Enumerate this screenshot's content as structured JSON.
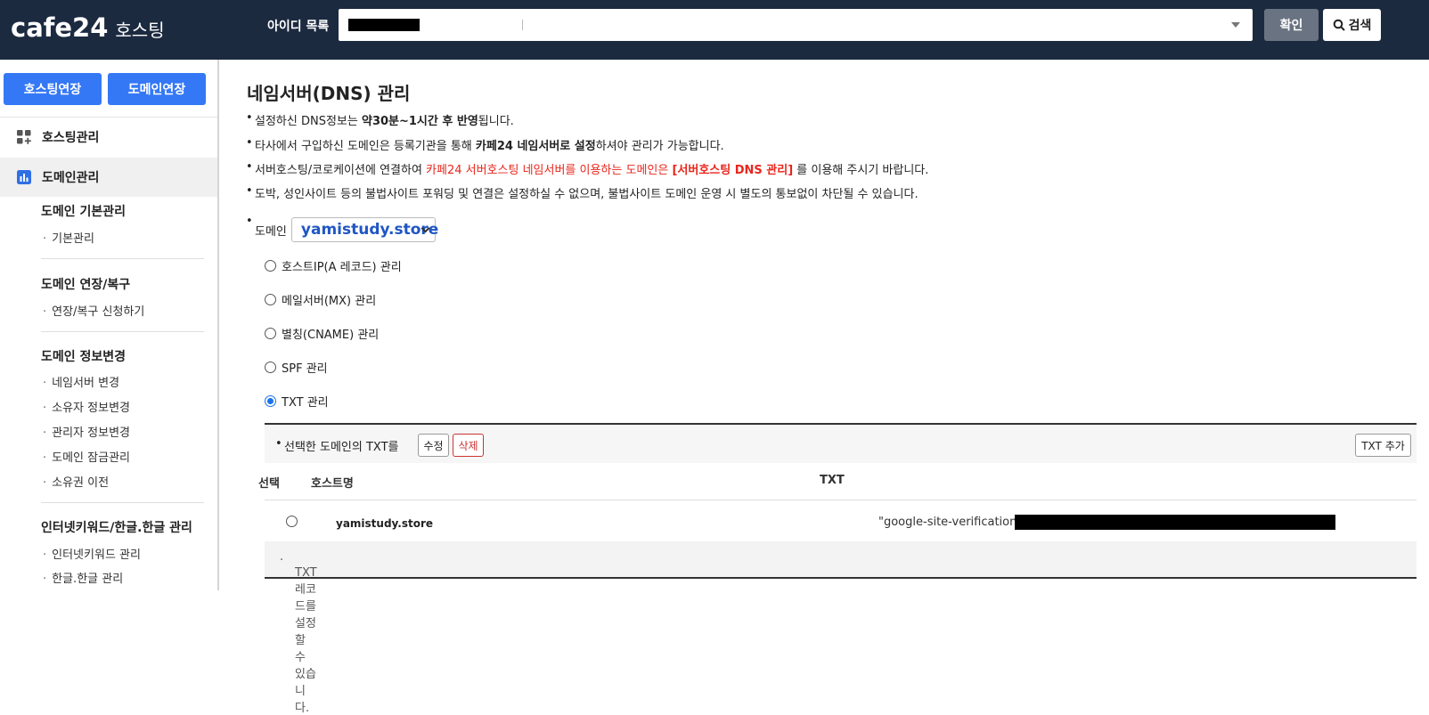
{
  "header": {
    "logo_main": "cafe24",
    "logo_sub": "호스팅",
    "id_label": "아이디 목록",
    "confirm_label": "확인",
    "search_label": "검색",
    "search_icon": "search-icon"
  },
  "sidebar": {
    "hosting_extend_label": "호스팅연장",
    "domain_extend_label": "도메인연장",
    "menus": [
      {
        "label": "호스팅관리",
        "icon": "grid-plus-icon"
      },
      {
        "label": "도메인관리",
        "icon": "bar-chart-icon"
      }
    ],
    "groups": [
      {
        "title": "도메인 기본관리",
        "items": [
          "기본관리"
        ]
      },
      {
        "title": "도메인 연장/복구",
        "items": [
          "연장/복구 신청하기"
        ]
      },
      {
        "title": "도메인 정보변경",
        "items": [
          "네임서버 변경",
          "소유자 정보변경",
          "관리자 정보변경",
          "도메인 잠금관리",
          "소유권 이전"
        ]
      },
      {
        "title": "인터넷키워드/한글.한글 관리",
        "items": [
          "인터넷키워드 관리",
          "한글.한글 관리"
        ]
      }
    ]
  },
  "main": {
    "title": "네임서버(DNS) 관리",
    "notices": {
      "n1_a": "설정하신 DNS정보는 ",
      "n1_b": "약30분~1시간 후 반영",
      "n1_c": "됩니다.",
      "n2_a": "타사에서 구입하신 도메인은 등록기관을 통해 ",
      "n2_b": "카페24 네임서버로 설정",
      "n2_c": "하셔야 관리가 가능합니다.",
      "n3_a": "서버호스팅/코로케이션에 연결하여 ",
      "n3_b": "카페24 서버호스팅 네임서버를 이용하는 도메인은 ",
      "n3_c": "[서버호스팅 DNS 관리]",
      "n3_d": " 를 이용해 주시기 바랍니다.",
      "n4": "도박, 성인사이트 등의 불법사이트 포워딩 및 연결은 설정하실 수 없으며, 불법사이트 도메인 운영 시 별도의 통보없이 차단될 수 있습니다."
    },
    "domain_label": "도메인",
    "domain_value": "yamistudy.store",
    "record_types": [
      {
        "label": "호스트IP(A 레코드) 관리",
        "checked": false
      },
      {
        "label": "메일서버(MX) 관리",
        "checked": false
      },
      {
        "label": "별칭(CNAME) 관리",
        "checked": false
      },
      {
        "label": "SPF 관리",
        "checked": false
      },
      {
        "label": "TXT 관리",
        "checked": true
      }
    ],
    "txt_toolbar": {
      "label": "선택한 도메인의 TXT를",
      "edit": "수정",
      "delete": "삭제",
      "add": "TXT 추가"
    },
    "table": {
      "headers": [
        "선택",
        "호스트명",
        "TXT"
      ],
      "rows": [
        {
          "host": "yamistudy.store",
          "txt": "\"google-site-verification="
        }
      ]
    },
    "foot_note": "TXT레코드를 설정할 수 있습니다."
  }
}
